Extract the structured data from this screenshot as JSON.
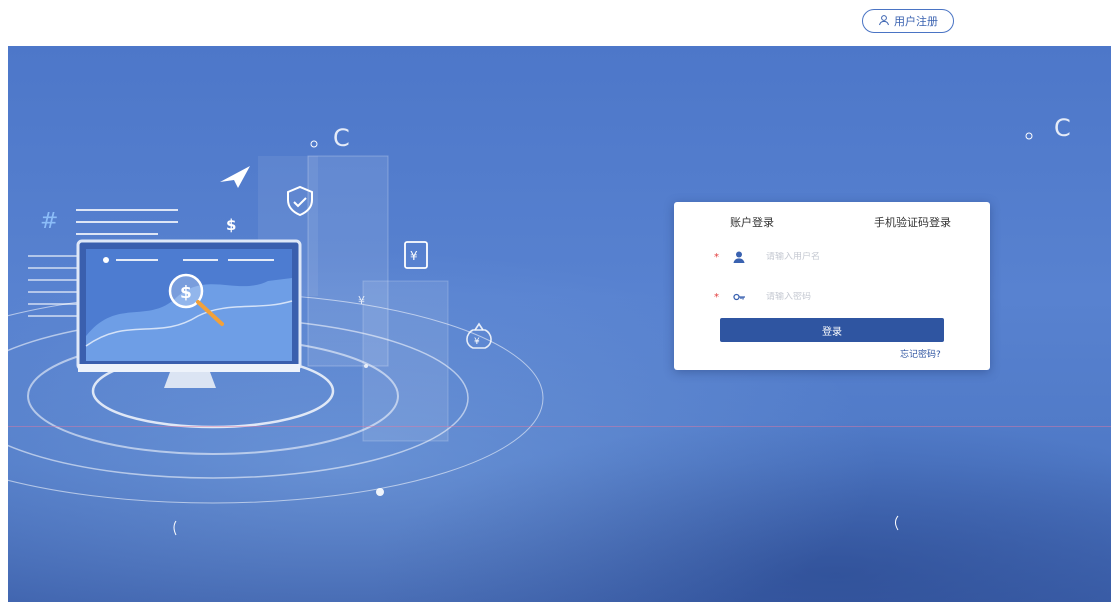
{
  "header": {
    "register_label": "用户注册"
  },
  "login": {
    "tabs": [
      {
        "label": "账户登录"
      },
      {
        "label": "手机验证码登录"
      }
    ],
    "username": {
      "placeholder": "请输入用户名",
      "value": ""
    },
    "password": {
      "placeholder": "请输入密码",
      "value": ""
    },
    "required_mark": "*",
    "submit_label": "登录",
    "forgot_label": "忘记密码?"
  },
  "illustration": {
    "symbols": {
      "hash": "#",
      "dollar": "$",
      "coin_dollar": "$",
      "yen": "¥"
    },
    "icons": [
      "paper-plane-icon",
      "shield-check-icon",
      "document-yen-icon",
      "money-bag-icon",
      "monitor-icon"
    ]
  },
  "colors": {
    "primary": "#2f55a1",
    "hero_bg": "#5580cd",
    "required": "#e23c3c"
  }
}
